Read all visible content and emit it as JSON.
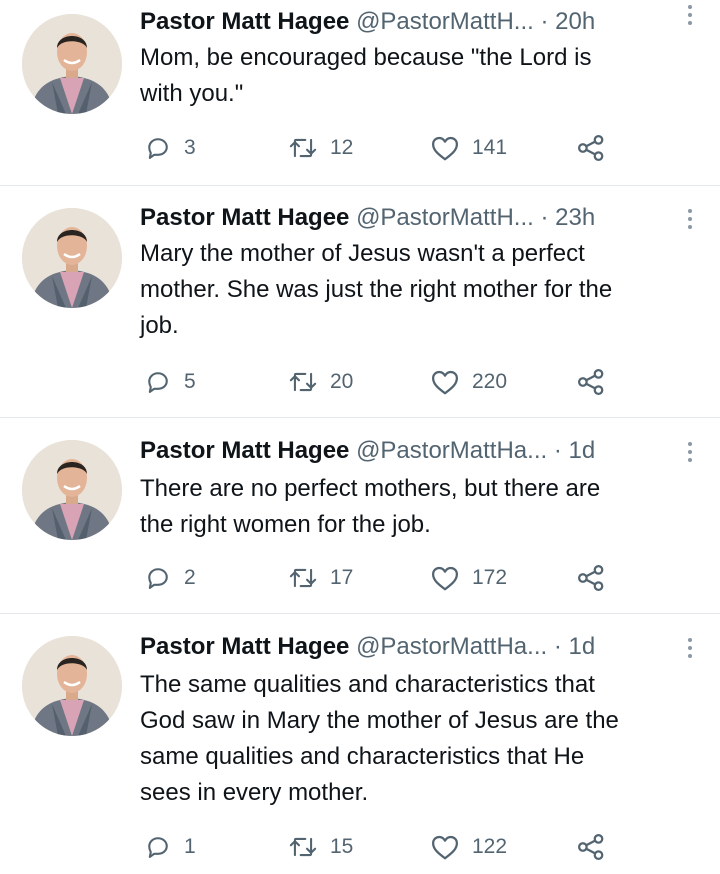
{
  "tweets": [
    {
      "name": "Pastor Matt Hagee",
      "handle": "@PastorMattH...",
      "separator": "·",
      "time": "20h",
      "lines": [
        "Mom, be encouraged because \"the Lord is",
        "with you.\""
      ],
      "replies": "3",
      "retweets": "12",
      "likes": "141"
    },
    {
      "name": "Pastor Matt Hagee",
      "handle": "@PastorMattH...",
      "separator": "·",
      "time": "23h",
      "lines": [
        "Mary the mother of Jesus wasn't a perfect",
        "mother. She was just the right mother for the",
        "job."
      ],
      "replies": "5",
      "retweets": "20",
      "likes": "220"
    },
    {
      "name": "Pastor Matt Hagee",
      "handle": "@PastorMattHa...",
      "separator": "·",
      "time": "1d",
      "lines": [
        "There are no perfect mothers, but there are",
        "the right women for the job."
      ],
      "replies": "2",
      "retweets": "17",
      "likes": "172"
    },
    {
      "name": "Pastor Matt Hagee",
      "handle": "@PastorMattHa...",
      "separator": "·",
      "time": "1d",
      "lines": [
        "The same qualities and characteristics that",
        "God saw in Mary the mother of Jesus are the",
        "same qualities and characteristics that He",
        "sees in every mother."
      ],
      "replies": "1",
      "retweets": "15",
      "likes": "122"
    }
  ]
}
